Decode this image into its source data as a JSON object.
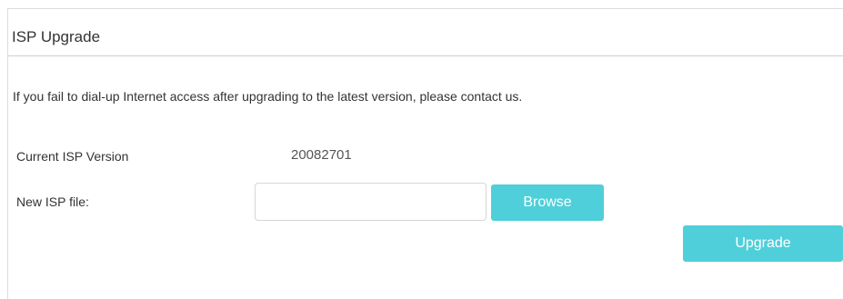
{
  "section": {
    "title": "ISP Upgrade",
    "notice": "If you fail to dial-up Internet access after upgrading to the latest version, please contact us."
  },
  "current_version": {
    "label": "Current ISP Version",
    "value": "20082701"
  },
  "new_file": {
    "label": "New ISP file:",
    "value": "",
    "browse_label": "Browse"
  },
  "actions": {
    "upgrade_label": "Upgrade"
  },
  "colors": {
    "button_bg": "#4fcfd9",
    "button_text": "#ffffff",
    "border": "#dcdcdc"
  }
}
